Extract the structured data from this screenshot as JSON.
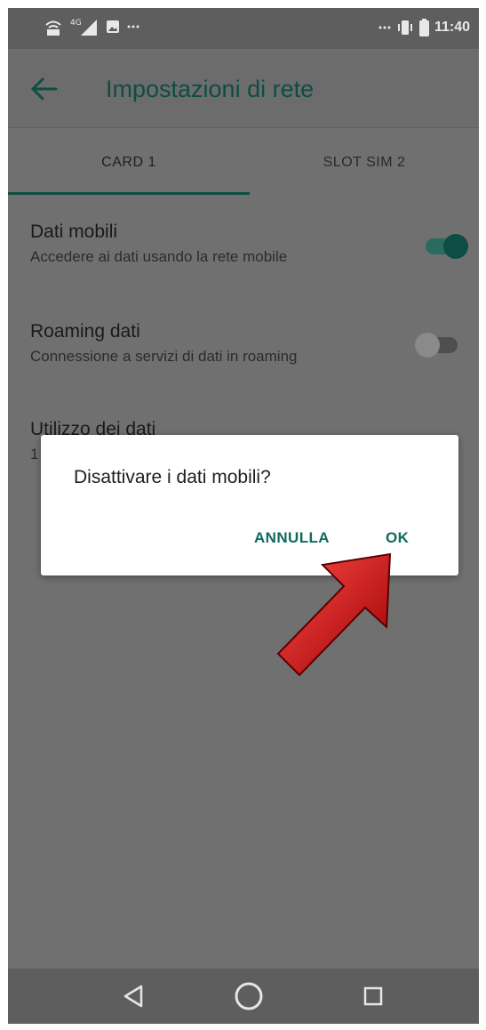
{
  "status_bar": {
    "left_icons": [
      "wifi-calling-icon",
      "signal-4g-icon",
      "image-notification-icon",
      "more-dots-icon"
    ],
    "right_icons": [
      "more-dots-icon",
      "vibrate-icon",
      "battery-icon"
    ],
    "time": "11:40"
  },
  "app_bar": {
    "title": "Impostazioni di rete",
    "back_icon": "arrow-left-icon"
  },
  "tabs": [
    {
      "label": "CARD 1",
      "selected": true
    },
    {
      "label": "SLOT SIM 2",
      "selected": false
    }
  ],
  "settings": {
    "mobile_data": {
      "title": "Dati mobili",
      "subtitle": "Accedere ai dati usando la rete mobile",
      "enabled": true
    },
    "data_roaming": {
      "title": "Roaming dati",
      "subtitle": "Connessione a servizi di dati in roaming",
      "enabled": false
    },
    "data_usage": {
      "title": "Utilizzo dei dati",
      "subtitle_partial": "1"
    }
  },
  "dialog": {
    "message": "Disattivare i dati mobili?",
    "cancel_label": "ANNULLA",
    "ok_label": "OK"
  },
  "nav_bar": {
    "icons": [
      "back-triangle-icon",
      "home-circle-icon",
      "recents-square-icon"
    ]
  },
  "colors": {
    "accent": "#0e4d44",
    "button_text": "#0e6b5c",
    "scrim_background": "#707070",
    "arrow": "#d01010"
  }
}
